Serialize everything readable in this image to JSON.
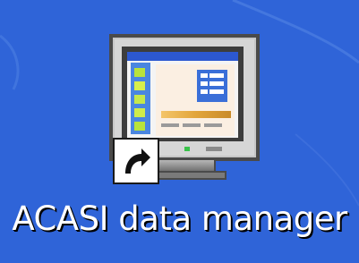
{
  "desktop": {
    "background_color": "#2f64d8",
    "shortcut": {
      "label": "ACASI data manager",
      "icon": "computer-monitor-icon",
      "overlay_icon": "shortcut-arrow-icon"
    }
  }
}
